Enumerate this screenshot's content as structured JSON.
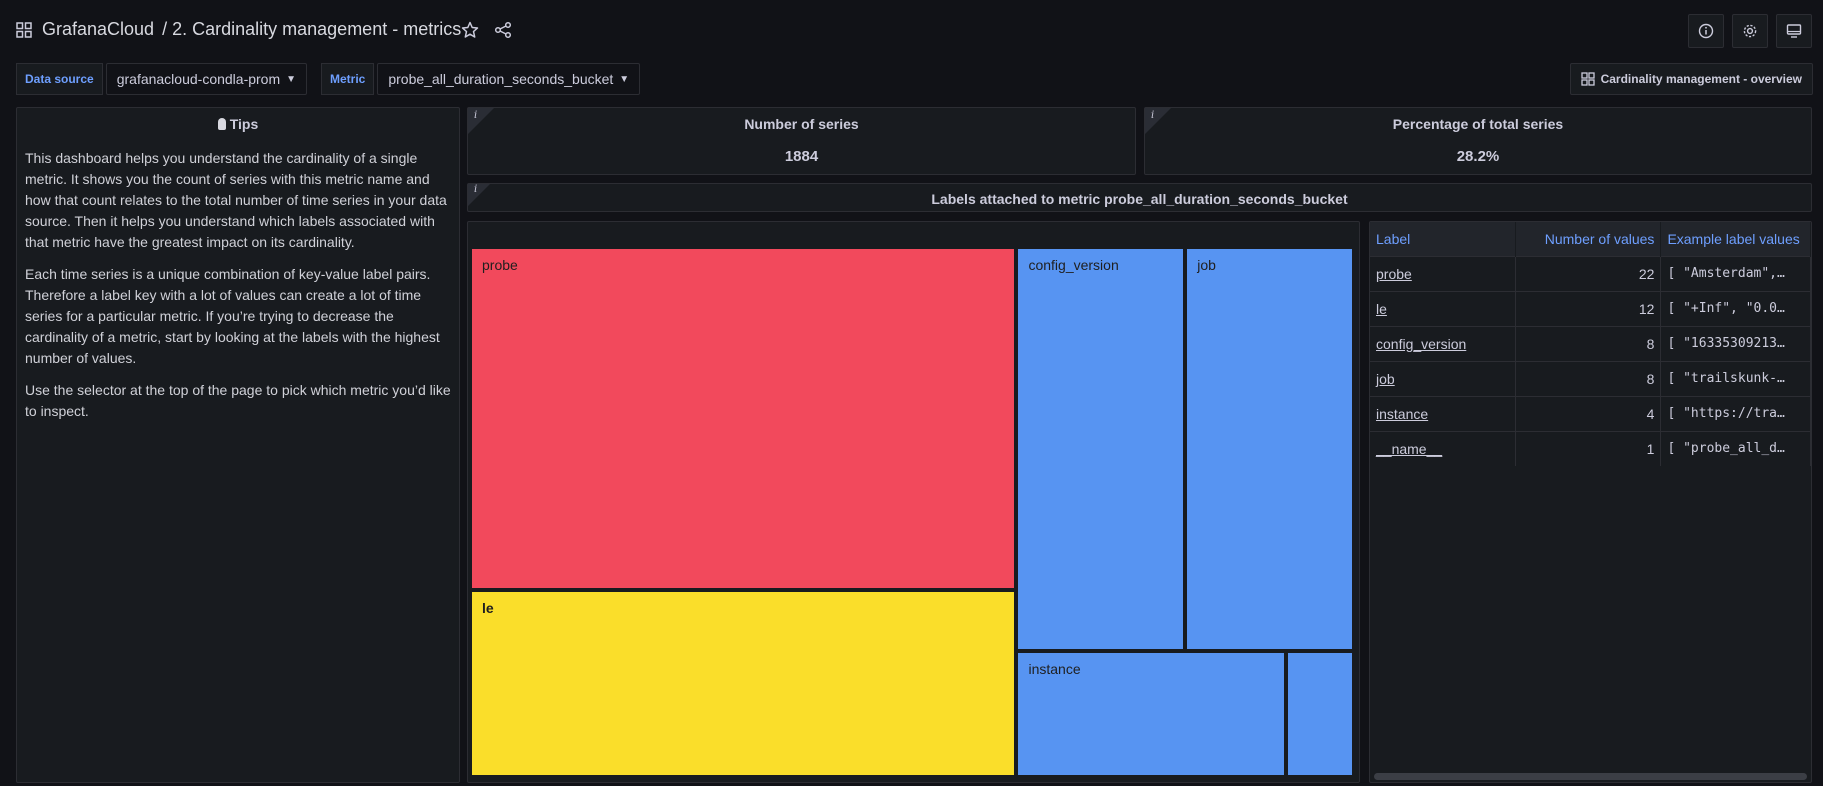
{
  "header": {
    "org": "GrafanaCloud",
    "separator": "/",
    "dashboard_title": "2. Cardinality management - metrics"
  },
  "icons": {
    "apps": "apps-icon",
    "star": "star-icon",
    "share": "share-icon",
    "info": "info-icon",
    "settings": "gear-icon",
    "tv": "tv-monitor-icon",
    "overview": "dashboard-grid-icon"
  },
  "variables": {
    "datasource_label": "Data source",
    "datasource_value": "grafanacloud-condla-prom",
    "metric_label": "Metric",
    "metric_value": "probe_all_duration_seconds_bucket"
  },
  "overview_link": "Cardinality management - overview",
  "tips": {
    "title": "Tips",
    "paragraphs": [
      "This dashboard helps you understand the cardinality of a single metric. It shows you the count of series with this metric name and how that count relates to the total number of time series in your data source. Then it helps you understand which labels associated with that metric have the greatest impact on its cardinality.",
      "Each time series is a unique combination of key-value label pairs. Therefore a label key with a lot of values can create a lot of time series for a particular metric. If you’re trying to decrease the cardinality of a metric, start by looking at the labels with the highest number of values.",
      "Use the selector at the top of the page to pick which metric you’d like to inspect."
    ]
  },
  "stats": {
    "series_title": "Number of series",
    "series_value": "1884",
    "pct_title": "Percentage of total series",
    "pct_value": "28.2%"
  },
  "labels_row_title": "Labels attached to metric probe_all_duration_seconds_bucket",
  "treemap": [
    {
      "label": "probe",
      "value": 22,
      "color": "#f2495c"
    },
    {
      "label": "le",
      "value": 12,
      "color": "#fade2a"
    },
    {
      "label": "config_version",
      "value": 8,
      "color": "#5794f2"
    },
    {
      "label": "job",
      "value": 8,
      "color": "#5794f2"
    },
    {
      "label": "instance",
      "value": 4,
      "color": "#5794f2"
    },
    {
      "label": "",
      "value": 1,
      "color": "#5794f2"
    }
  ],
  "table": {
    "headers": [
      "Label",
      "Number of values",
      "Example label values"
    ],
    "rows": [
      {
        "label": "probe",
        "count": "22",
        "example": "[ \"Amsterdam\",…"
      },
      {
        "label": "le",
        "count": "12",
        "example": "[ \"+Inf\", \"0.0…"
      },
      {
        "label": "config_version",
        "count": "8",
        "example": "[ \"16335309213…"
      },
      {
        "label": "job",
        "count": "8",
        "example": "[ \"trailskunk-…"
      },
      {
        "label": "instance",
        "count": "4",
        "example": "[ \"https://tra…"
      },
      {
        "label": "__name__",
        "count": "1",
        "example": "[ \"probe_all_d…"
      }
    ]
  }
}
